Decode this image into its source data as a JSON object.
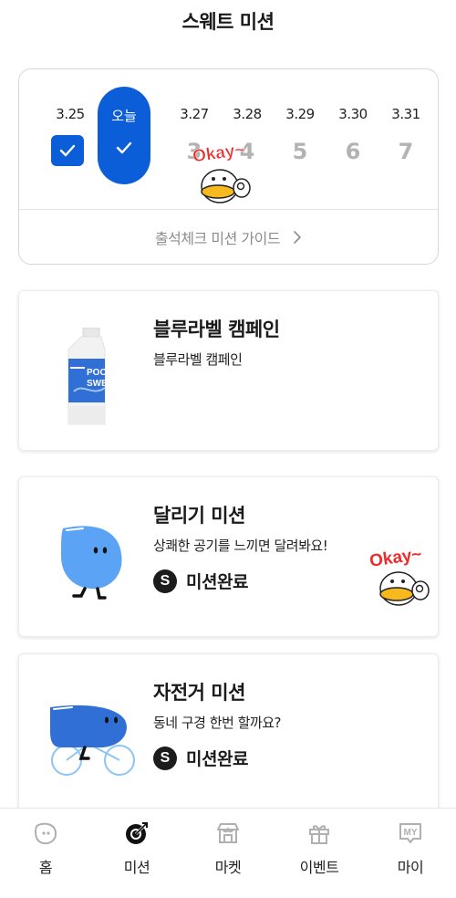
{
  "header": {
    "title": "스웨트 미션"
  },
  "attendance": {
    "days": [
      {
        "date": "3.25",
        "num": "",
        "checked": true
      },
      {
        "date": "오늘",
        "num": "",
        "checked": true,
        "today": true
      },
      {
        "date": "3.27",
        "num": "3",
        "checked": false
      },
      {
        "date": "3.28",
        "num": "4",
        "checked": false
      },
      {
        "date": "3.29",
        "num": "5",
        "checked": false
      },
      {
        "date": "3.30",
        "num": "6",
        "checked": false
      },
      {
        "date": "3.31",
        "num": "7",
        "checked": false
      }
    ],
    "sticker_text": "Okay~",
    "guide_label": "출석체크 미션 가이드"
  },
  "missions": [
    {
      "title": "블루라벨 캠페인",
      "desc": "블루라벨 캠페인",
      "done_label": "",
      "bottle_text_1": "POC",
      "bottle_text_2": "SWE"
    },
    {
      "title": "달리기 미션",
      "desc": "상쾌한 공기를 느끼면 달려봐요!",
      "done_badge": "S",
      "done_label": "미션완료",
      "sticker_text": "Okay~"
    },
    {
      "title": "자전거 미션",
      "desc": "동네 구경 한번 할까요?",
      "done_badge": "S",
      "done_label": "미션완료"
    }
  ],
  "nav": [
    {
      "label": "홈",
      "icon": "home-face-icon"
    },
    {
      "label": "미션",
      "icon": "mission-target-icon",
      "active": true
    },
    {
      "label": "마켓",
      "icon": "market-store-icon"
    },
    {
      "label": "이벤트",
      "icon": "event-gift-icon"
    },
    {
      "label": "마이",
      "icon": "my-page-icon",
      "icon_text": "MY"
    }
  ],
  "colors": {
    "accent": "#0b5ed8",
    "muted_number": "#b3b3b3",
    "character_blue": "#5ba3f5"
  }
}
